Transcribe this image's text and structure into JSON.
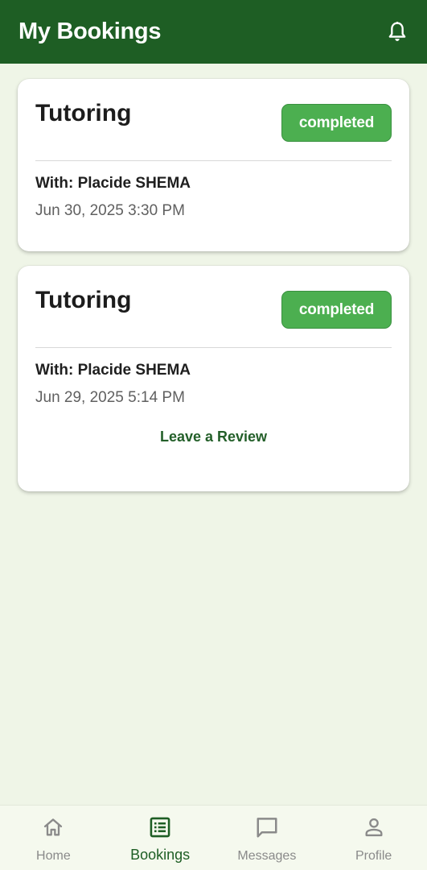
{
  "header": {
    "title": "My Bookings",
    "notification_icon": "bell-icon"
  },
  "bookings": [
    {
      "title": "Tutoring",
      "status": "completed",
      "with": "With: Placide SHEMA",
      "datetime": "Jun 30, 2025 3:30 PM"
    },
    {
      "title": "Tutoring",
      "status": "completed",
      "with": "With: Placide SHEMA",
      "datetime": "Jun 29, 2025 5:14 PM",
      "action": "Leave a Review"
    }
  ],
  "bottom_nav": {
    "items": [
      {
        "label": "Home",
        "icon": "home-icon",
        "active": false
      },
      {
        "label": "Bookings",
        "icon": "list-icon",
        "active": true
      },
      {
        "label": "Messages",
        "icon": "chat-icon",
        "active": false
      },
      {
        "label": "Profile",
        "icon": "person-icon",
        "active": false
      }
    ]
  },
  "colors": {
    "primary": "#1e5e24",
    "status_completed": "#4caf50",
    "background": "#eff5e7",
    "inactive": "#8a8a8a"
  }
}
